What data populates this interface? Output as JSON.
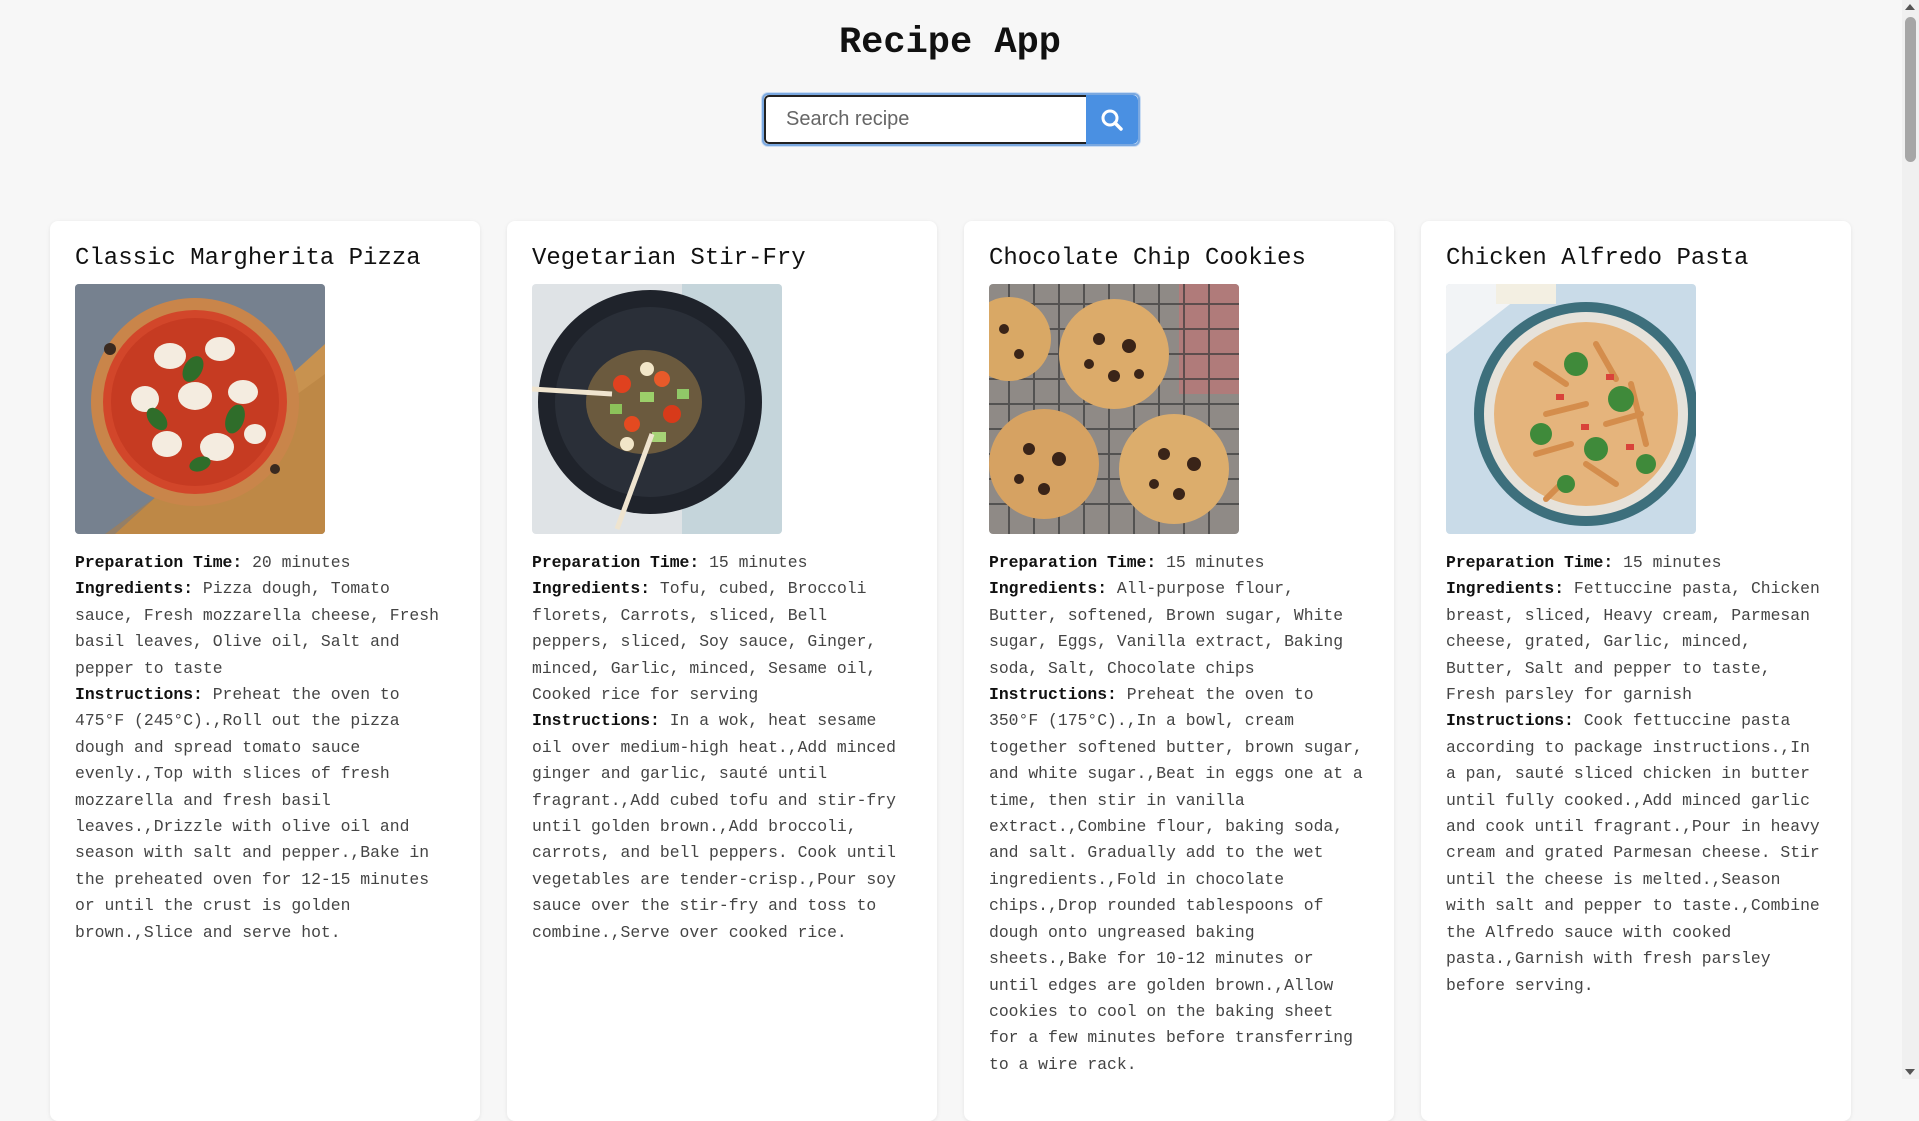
{
  "app": {
    "title": "Recipe App"
  },
  "search": {
    "placeholder": "Search recipe",
    "button_icon": "search-icon",
    "accent": "#4a90e2"
  },
  "labels": {
    "prep": "Preparation Time:",
    "ingredients": "Ingredients:",
    "instructions": "Instructions:"
  },
  "recipes": [
    {
      "name": "Classic Margherita Pizza",
      "prep_time": "20 minutes",
      "ingredients": "Pizza dough, Tomato sauce, Fresh mozzarella cheese, Fresh basil leaves, Olive oil, Salt and pepper to taste",
      "instructions": "Preheat the oven to 475°F (245°C).,Roll out the pizza dough and spread tomato sauce evenly.,Top with slices of fresh mozzarella and fresh basil leaves.,Drizzle with olive oil and season with salt and pepper.,Bake in the preheated oven for 12-15 minutes or until the crust is golden brown.,Slice and serve hot."
    },
    {
      "name": "Vegetarian Stir-Fry",
      "prep_time": "15 minutes",
      "ingredients": "Tofu, cubed, Broccoli florets, Carrots, sliced, Bell peppers, sliced, Soy sauce, Ginger, minced, Garlic, minced, Sesame oil, Cooked rice for serving",
      "instructions": "In a wok, heat sesame oil over medium-high heat.,Add minced ginger and garlic, sauté until fragrant.,Add cubed tofu and stir-fry until golden brown.,Add broccoli, carrots, and bell peppers. Cook until vegetables are tender-crisp.,Pour soy sauce over the stir-fry and toss to combine.,Serve over cooked rice."
    },
    {
      "name": "Chocolate Chip Cookies",
      "prep_time": "15 minutes",
      "ingredients": "All-purpose flour, Butter, softened, Brown sugar, White sugar, Eggs, Vanilla extract, Baking soda, Salt, Chocolate chips",
      "instructions": "Preheat the oven to 350°F (175°C).,In a bowl, cream together softened butter, brown sugar, and white sugar.,Beat in eggs one at a time, then stir in vanilla extract.,Combine flour, baking soda, and salt. Gradually add to the wet ingredients.,Fold in chocolate chips.,Drop rounded tablespoons of dough onto ungreased baking sheets.,Bake for 10-12 minutes or until edges are golden brown.,Allow cookies to cool on the baking sheet for a few minutes before transferring to a wire rack."
    },
    {
      "name": "Chicken Alfredo Pasta",
      "prep_time": "15 minutes",
      "ingredients": "Fettuccine pasta, Chicken breast, sliced, Heavy cream, Parmesan cheese, grated, Garlic, minced, Butter, Salt and pepper to taste, Fresh parsley for garnish",
      "instructions": "Cook fettuccine pasta according to package instructions.,In a pan, sauté sliced chicken in butter until fully cooked.,Add minced garlic and cook until fragrant.,Pour in heavy cream and grated Parmesan cheese. Stir until the cheese is melted.,Season with salt and pepper to taste.,Combine the Alfredo sauce with cooked pasta.,Garnish with fresh parsley before serving."
    }
  ]
}
